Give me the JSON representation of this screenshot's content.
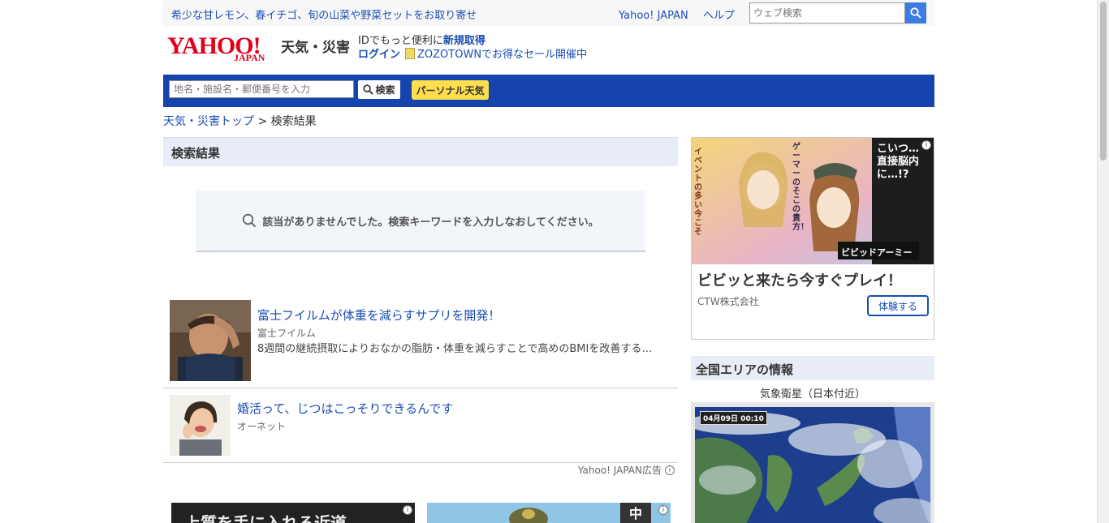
{
  "topbar": {
    "promo": "希少な甘レモン、春イチゴ、旬の山菜や野菜セットをお取り寄せ",
    "yahoo_japan": "Yahoo! JAPAN",
    "help": "ヘルプ",
    "web_search_placeholder": "ウェブ検索"
  },
  "header": {
    "logo_main": "YAHOO!",
    "logo_sub": "JAPAN",
    "service_name": "天気・災害",
    "id_text": "IDでもっと便利に",
    "register_link": "新規取得",
    "login_link": "ログイン",
    "zozo_text": "ZOZOTOWNでお得なセール開催中"
  },
  "search_band": {
    "placeholder": "地名・施設名・郵便番号を入力",
    "search_button": "検索",
    "personal_button": "パーソナル天気"
  },
  "breadcrumb": {
    "home": "天気・災害トップ",
    "separator": ">",
    "current": "検索結果"
  },
  "results": {
    "heading": "検索結果",
    "no_result_message": "該当がありませんでした。検索キーワードを入力しなおしてください。"
  },
  "ads": [
    {
      "title": "富士フイルムが体重を減らすサプリを開発！",
      "sponsor": "富士フイルム",
      "description": "8週間の継続摂取によりおなかの脂肪・体重を減らすことで高めのBMIを改善する…"
    },
    {
      "title": "婚活って、じつはこっそりできるんです",
      "sponsor": "オーネット",
      "description": ""
    }
  ],
  "ad_credit": "Yahoo! JAPAN広告",
  "banner_left_text": "上質を手に入れる近道",
  "banner_right_badge": "中",
  "side_ad": {
    "headline": "ビビッと来たら今すぐプレイ！",
    "company": "CTW株式会社",
    "cta": "体験する",
    "art_text_1": "イベントの多い今こそ",
    "art_text_2": "ゲーマーのそこの貴方！",
    "art_text_3": "こいつ…直接脳内に…!?",
    "art_logo": "ビビッドアーミー"
  },
  "area_info": {
    "heading": "全国エリアの情報",
    "satellite_label": "気象衛星（日本付近）",
    "satellite_timestamp": "04月09日 00:10"
  },
  "colors": {
    "link": "#1a4eb3",
    "brand_red": "#e0001c",
    "band_blue": "#1544ad",
    "personal_yellow": "#ffde4d"
  }
}
